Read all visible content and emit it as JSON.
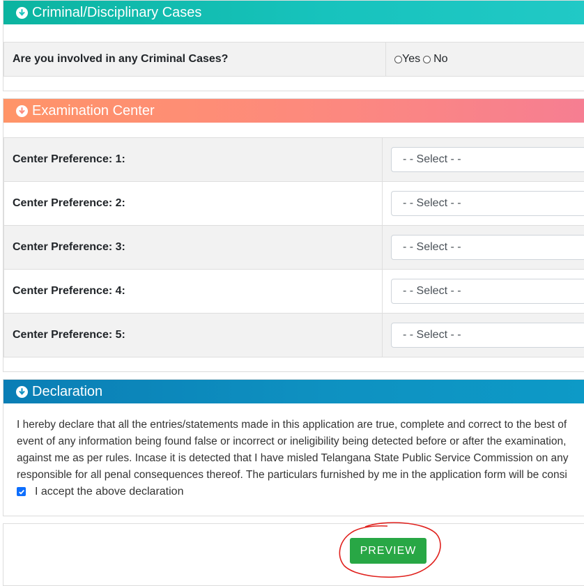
{
  "criminal": {
    "title": "Criminal/Disciplinary Cases",
    "question": "Are you involved in any Criminal Cases?",
    "option_yes": "Yes",
    "option_no": "No"
  },
  "exam_center": {
    "title": "Examination Center",
    "preferences": [
      {
        "label": "Center Preference: 1:",
        "value": "- - Select - -"
      },
      {
        "label": "Center Preference: 2:",
        "value": "- - Select - -"
      },
      {
        "label": "Center Preference: 3:",
        "value": "- - Select - -"
      },
      {
        "label": "Center Preference: 4:",
        "value": "- - Select - -"
      },
      {
        "label": "Center Preference: 5:",
        "value": "- - Select - -"
      }
    ]
  },
  "declaration": {
    "title": "Declaration",
    "lines": [
      "I hereby declare that all the entries/statements made in this application are true, complete and correct to the best of",
      "event of any information being found false or incorrect or ineligibility being detected before or after the examination,",
      "against me as per rules. Incase it is detected that I have misled Telangana State Public Service Commission on any",
      "responsible for all penal consequences thereof. The particulars furnished by me in the application form will be consi"
    ],
    "accept_label": "I accept the above declaration",
    "accepted": true
  },
  "actions": {
    "preview_label": "PREVIEW"
  },
  "colors": {
    "teal_header": "#17c3bd",
    "orange_header": "#fd8a7c",
    "blue_header": "#0e91c1",
    "button_green": "#28a745",
    "annotation_red": "#e0201c"
  }
}
